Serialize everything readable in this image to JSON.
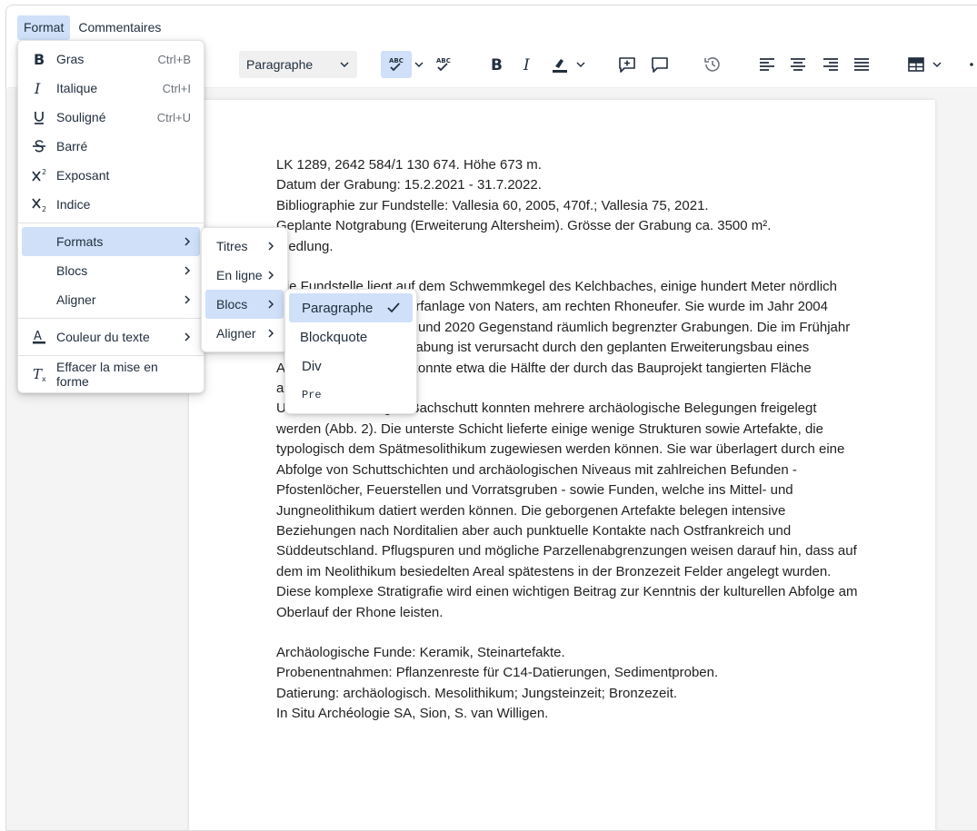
{
  "menubar": {
    "format": "Format",
    "comments": "Commentaires"
  },
  "toolbar": {
    "block_format": "Paragraphe",
    "icons": [
      "spellcheck-icon",
      "spellcheck-language-icon",
      "bold-icon",
      "italic-icon",
      "highlight-icon",
      "add-comment-icon",
      "show-comments-icon",
      "history-icon",
      "align-left-icon",
      "align-center-icon",
      "align-right-icon",
      "justify-icon",
      "table-icon",
      "more-icon"
    ]
  },
  "format_menu": {
    "bold": {
      "label": "Gras",
      "shortcut": "Ctrl+B"
    },
    "italic": {
      "label": "Italique",
      "shortcut": "Ctrl+I"
    },
    "underline": {
      "label": "Souligné",
      "shortcut": "Ctrl+U"
    },
    "strike": {
      "label": "Barré"
    },
    "superscript": {
      "label": "Exposant"
    },
    "subscript": {
      "label": "Indice"
    },
    "formats": {
      "label": "Formats"
    },
    "blocks": {
      "label": "Blocs"
    },
    "align": {
      "label": "Aligner"
    },
    "text_color": {
      "label": "Couleur du texte"
    },
    "clear": {
      "label": "Effacer la mise en forme"
    }
  },
  "formats_submenu": {
    "titles": "Titres",
    "inline": "En ligne",
    "blocks": "Blocs",
    "align": "Aligner"
  },
  "blocks_submenu": {
    "paragraph": "Paragraphe",
    "blockquote": "Blockquote",
    "div": "Div",
    "pre": "Pre"
  },
  "document": {
    "p1": "LK 1289, 2642 584/1 130 674. Höhe 673 m.\nDatum der Grabung: 15.2.2021 - 31.7.2022.\nBibliographie zur Fundstelle: Vallesia 60, 2005, 470f.; Vallesia 75, 2021.\nGeplante Notgrabung (Erweiterung Altersheim). Grösse der Grabung ca. 3500 m².\nSiedlung.",
    "p2": "Die Fundstelle liegt auf dem Schwemmkegel des Kelchbaches, einige hundert Meter nördlich der mittelalterlichen Dorfanlage von Naters, am rechten Rhoneufer. Sie wurde im Jahr 2004 entdeckt und war 2004 und 2020 Gegenstand räumlich begrenzter Grabungen. Die im Frühjahr 2021 begonnene Notgrabung ist verursacht durch den geplanten Erweiterungsbau eines Altersheimes. Bislang konnte etwa die Hälfte der durch das Bauprojekt tangierten Fläche ausgegraben werden.\nUnter dem mächtigen Bachschutt konnten mehrere archäologische Belegungen freigelegt werden (Abb. 2). Die unterste Schicht lieferte einige wenige Strukturen sowie Artefakte, die typologisch dem Spätmesolithikum zugewiesen werden können. Sie war überlagert durch eine Abfolge von Schuttschichten und archäologischen Niveaus mit zahlreichen Befunden - Pfostenlöcher, Feuerstellen und Vorratsgruben - sowie Funden, welche ins Mittel- und Jungneolithikum datiert werden können. Die geborgenen Artefakte belegen intensive Beziehungen nach Norditalien aber auch punktuelle Kontakte nach Ostfrankreich und Süddeutschland. Pflugspuren und mögliche Parzellenabgrenzungen weisen darauf hin, dass auf dem im Neolithikum besiedelten Areal spätestens in der Bronzezeit Felder angelegt wurden. Diese komplexe Stratigrafie wird einen wichtigen Beitrag zur Kenntnis der kulturellen Abfolge am Oberlauf der Rhone leisten.",
    "p3": "Archäologische Funde: Keramik, Steinartefakte.\nProbenentnahmen: Pflanzenreste für C14-Datierungen, Sedimentproben.\nDatierung: archäologisch. Mesolithikum; Jungsteinzeit; Bronzezeit.\nIn Situ Archéologie SA, Sion, S. van Willigen."
  }
}
